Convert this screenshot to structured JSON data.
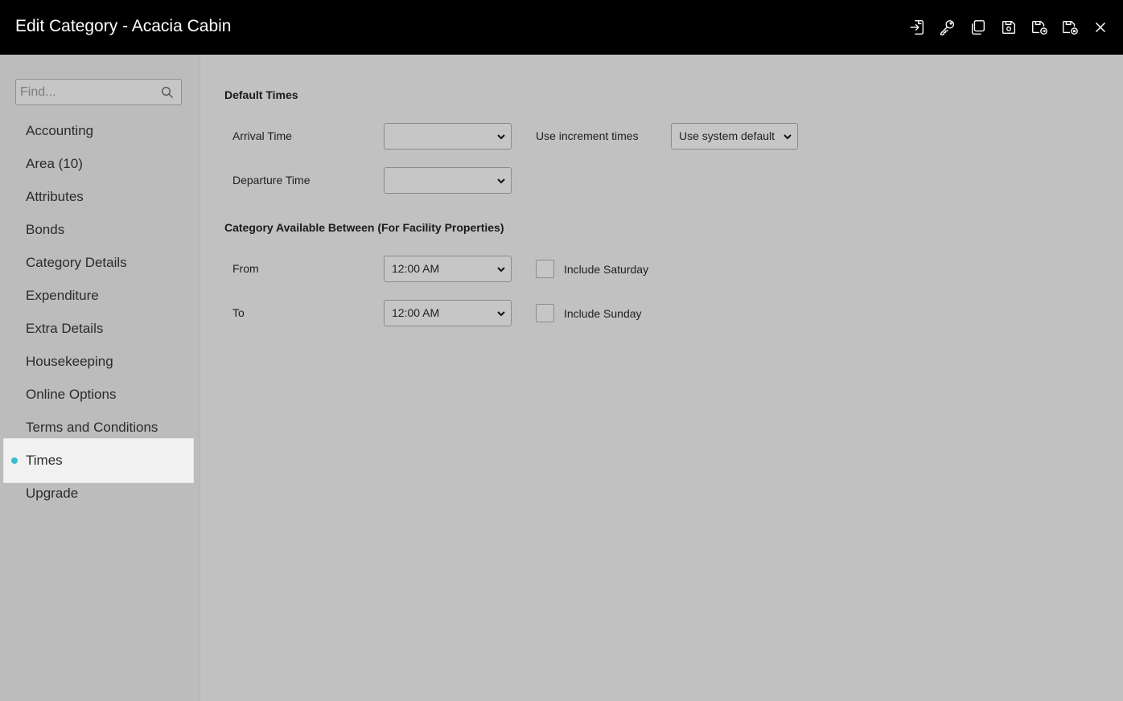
{
  "window": {
    "title": "Edit Category - Acacia Cabin",
    "toolbar": [
      {
        "name": "export-icon"
      },
      {
        "name": "key-icon"
      },
      {
        "name": "copy-icon"
      },
      {
        "name": "save-icon"
      },
      {
        "name": "save-and-go-icon"
      },
      {
        "name": "save-and-close-icon"
      },
      {
        "name": "close-icon"
      }
    ]
  },
  "sidebar": {
    "search_placeholder": "Find...",
    "items": [
      {
        "label": "Accounting"
      },
      {
        "label": "Area (10)"
      },
      {
        "label": "Attributes"
      },
      {
        "label": "Bonds"
      },
      {
        "label": "Category Details"
      },
      {
        "label": "Expenditure"
      },
      {
        "label": "Extra Details"
      },
      {
        "label": "Housekeeping"
      },
      {
        "label": "Online Options"
      },
      {
        "label": "Terms and Conditions"
      },
      {
        "label": "Times",
        "active": true
      },
      {
        "label": "Upgrade"
      }
    ],
    "active_color": "#3bbccc"
  },
  "main": {
    "default_times": {
      "heading": "Default Times",
      "arrival_label": "Arrival Time",
      "arrival_value": "",
      "increment_label": "Use increment times",
      "increment_value": "Use system default",
      "departure_label": "Departure Time",
      "departure_value": ""
    },
    "availability": {
      "heading": "Category Available Between (For Facility Properties)",
      "from_label": "From",
      "from_value": "12:00 AM",
      "to_label": "To",
      "to_value": "12:00 AM",
      "include_saturday_label": "Include Saturday",
      "include_saturday_checked": false,
      "include_sunday_label": "Include Sunday",
      "include_sunday_checked": false
    }
  }
}
